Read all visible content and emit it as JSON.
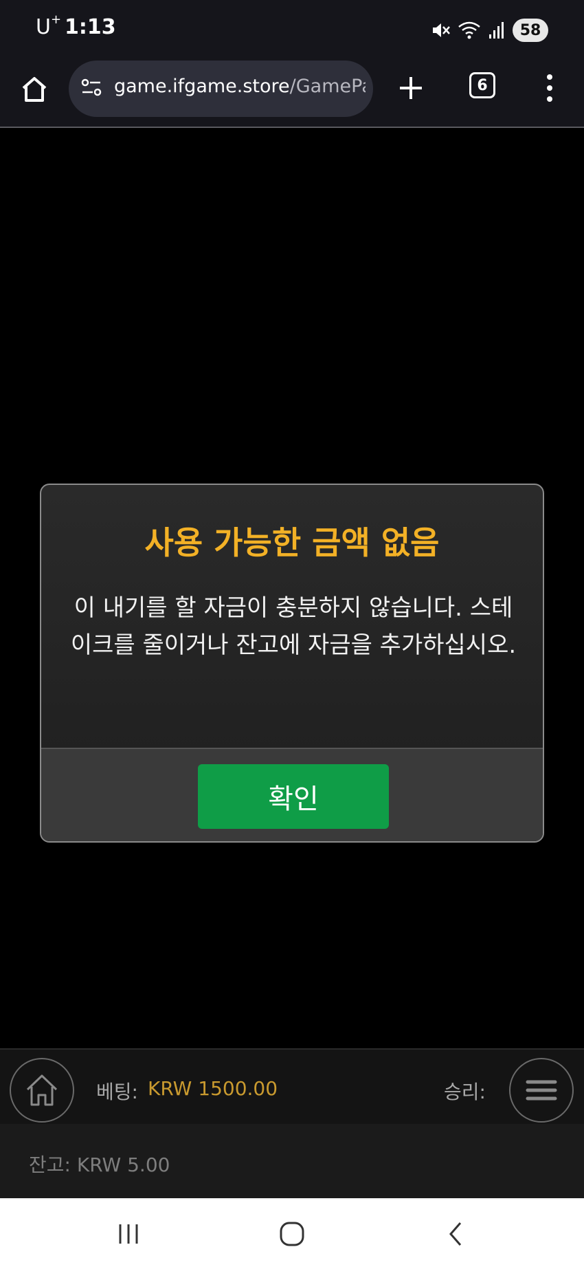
{
  "status_bar": {
    "carrier": "U",
    "carrier_plus": "+",
    "time": "1:13",
    "battery": "58",
    "icons": [
      "mute-icon",
      "wifi-icon",
      "signal-icon",
      "battery-icon"
    ]
  },
  "browser": {
    "url_host": "game.ifgame.store",
    "url_path": "/GamePage",
    "tab_count": "6",
    "icons": [
      "home-icon",
      "site-info-icon",
      "new-tab-icon",
      "tab-switcher-icon",
      "more-menu-icon"
    ]
  },
  "dialog": {
    "title": "사용 가능한 금액 없음",
    "message": "이 내기를 할 자금이 충분하지 않습니다. 스테이크를 줄이거나 잔고에 자금을 추가하십시오.",
    "confirm_label": "확인"
  },
  "game_bar": {
    "bet_label": "베팅:",
    "bet_value": "KRW 1500.00",
    "win_label": "승리:",
    "balance": "잔고: KRW 5.00"
  },
  "colors": {
    "title_accent": "#f3b126",
    "confirm_button": "#0f9d47",
    "bet_value": "#c99a2f"
  }
}
